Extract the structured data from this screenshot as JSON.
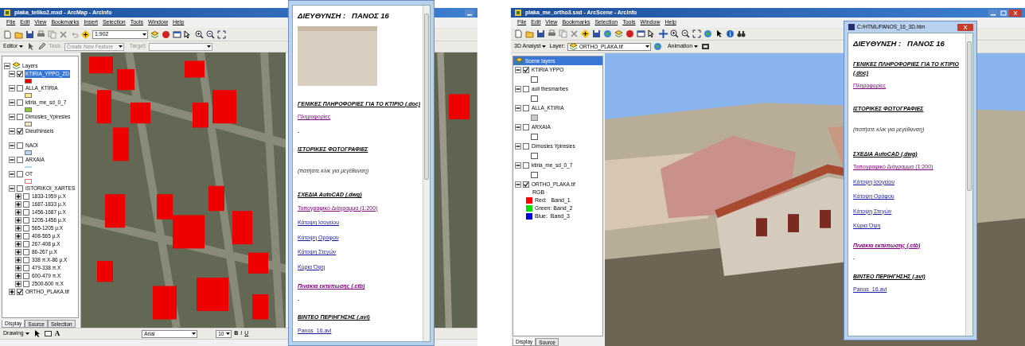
{
  "left_window": {
    "title": "plaka_teliko2.mxd - ArcMap - ArcInfo",
    "menu": [
      "File",
      "Edit",
      "View",
      "Bookmarks",
      "Insert",
      "Selection",
      "Tools",
      "Window",
      "Help"
    ],
    "scale": "1:902",
    "editor_toolbar": {
      "editor": "Editor",
      "task_label": "Task:",
      "task": "Create New Feature",
      "target_label": "Target:"
    },
    "layers": {
      "title": "Layers",
      "items": [
        {
          "label": "KTIRIA_YPPO_ZD",
          "checked": true,
          "selected": true,
          "expanded": true,
          "kind": "fill",
          "color": "#e60000"
        },
        {
          "label": "ALLA_KTIRIA",
          "checked": false,
          "selected": false,
          "expanded": true,
          "kind": "fill",
          "color": "#f5ee8a"
        },
        {
          "label": "ktiria_me_sd_0_7",
          "checked": false,
          "selected": false,
          "expanded": true,
          "kind": "fill",
          "color": "#8cc43c"
        },
        {
          "label": "Dimosies_Ypiresies",
          "checked": false,
          "selected": false,
          "expanded": true,
          "kind": "fill",
          "color": "#efe6c8"
        },
        {
          "label": "Dieuthinseis",
          "checked": true,
          "selected": false,
          "expanded": true,
          "kind": "plain"
        },
        {
          "label": "NAOI",
          "checked": false,
          "selected": false,
          "expanded": true,
          "kind": "fill",
          "color": "#bcd6ee"
        },
        {
          "label": "ARXAIA",
          "checked": false,
          "selected": false,
          "expanded": true,
          "kind": "line",
          "color": "#a8dcf0"
        },
        {
          "label": "OT",
          "checked": false,
          "selected": false,
          "expanded": true,
          "kind": "outline",
          "color": "#e07070"
        },
        {
          "label": "ISTORIKOI_XARTES",
          "checked": false,
          "selected": false,
          "expanded": true,
          "kind": "group",
          "children": [
            {
              "label": "1833-1959 μ.Χ",
              "checked": false,
              "selected": false,
              "expanded": false
            },
            {
              "label": "1687-1833 μ.Χ",
              "checked": false,
              "selected": false,
              "expanded": false
            },
            {
              "label": "1456-1687 μ.Χ",
              "checked": false,
              "selected": false,
              "expanded": false
            },
            {
              "label": "1205-1456 μ.Χ",
              "checked": false,
              "selected": false,
              "expanded": false
            },
            {
              "label": "565-1205 μ.Χ",
              "checked": false,
              "selected": false,
              "expanded": false
            },
            {
              "label": "408-565 μ.Χ",
              "checked": false,
              "selected": false,
              "expanded": false
            },
            {
              "label": "267-408 μ.Χ",
              "checked": false,
              "selected": false,
              "expanded": false
            },
            {
              "label": "86-267 μ.Χ",
              "checked": false,
              "selected": false,
              "expanded": false
            },
            {
              "label": "338 π.Χ-86 μ.Χ",
              "checked": false,
              "selected": false,
              "expanded": false
            },
            {
              "label": "479-338 π.Χ",
              "checked": false,
              "selected": false,
              "expanded": false
            },
            {
              "label": "600-479 π.Χ",
              "checked": false,
              "selected": false,
              "expanded": false
            },
            {
              "label": "2500-600 π.Χ",
              "checked": false,
              "selected": false,
              "expanded": false
            }
          ]
        },
        {
          "label": "ORTHO_PLAKA.tif",
          "checked": true,
          "selected": false,
          "expanded": false
        }
      ]
    },
    "tabs": [
      {
        "label": "Display",
        "selected": true
      },
      {
        "label": "Source",
        "selected": false
      },
      {
        "label": "Selection",
        "selected": false
      }
    ],
    "drawing_toolbar": {
      "drawing": "Drawing",
      "text_tool": "A",
      "font": "Arial",
      "size": "10",
      "bold": "B",
      "italic": "I",
      "underline": "U"
    }
  },
  "popup_left": {
    "heading": "ΔΙΕΥΘΥΝΣΗ :   ΠΑΝΟΣ 16",
    "blocks": [
      {
        "kind": "photo"
      },
      {
        "kind": "section",
        "text": "ΓΕΝΙΚΕΣ ΠΛΗΡΟΦΟΡΙΕΣ ΓΙΑ ΤΟ ΚΤΙΡΙΟ (.doc)"
      },
      {
        "kind": "link",
        "text": "Πληροφορίες",
        "visited": true
      },
      {
        "kind": "dash",
        "text": "-"
      },
      {
        "kind": "section",
        "text": "ΙΣΤΟΡΙΚΕΣ ΦΩΤΟΓΡΑΦΙΕΣ"
      },
      {
        "kind": "note",
        "text": "(πατήστε κλικ για μεγέθυνση)"
      },
      {
        "kind": "section",
        "text": "ΣΧΕΔΙΑ AutoCAD (.dwg)"
      },
      {
        "kind": "link",
        "text": "Τοπογραφικό Διάγραμμα (1:200)",
        "visited": true
      },
      {
        "kind": "link",
        "text": "Κάτοψη Ισογείου",
        "visited": false
      },
      {
        "kind": "link",
        "text": "Κάτοψη Ορόφου",
        "visited": false
      },
      {
        "kind": "link",
        "text": "Κάτοψη Στεγών",
        "visited": false
      },
      {
        "kind": "link",
        "text": "Κύρια Όψη",
        "visited": false
      },
      {
        "kind": "bold_link",
        "text": "Πινάκια εκτύπωσης (.ctb)",
        "visited": true
      },
      {
        "kind": "dash",
        "text": "-"
      },
      {
        "kind": "section",
        "text": "ΒΙΝΤΕΟ ΠΕΡΙΗΓΗΣΗΣ (.avi)"
      },
      {
        "kind": "link",
        "text": "Panos_16.avi",
        "visited": false
      }
    ]
  },
  "right_window": {
    "title": "plaka_me_ortho3.sxd - ArcScene - ArcInfo",
    "menu": [
      "File",
      "Edit",
      "View",
      "Bookmarks",
      "Selection",
      "Tools",
      "Window",
      "Help"
    ],
    "analyst_toolbar": {
      "analyst": "3D Analyst",
      "layer_label": "Layer:",
      "layer": "ORTHO_PLAKA.tif",
      "animation": "Animation"
    },
    "layers": {
      "title": "Scene layers",
      "items": [
        {
          "label": "KTIRIA YPPO",
          "checked": true,
          "expanded": true,
          "kind": "outline",
          "color": "#ffffff"
        },
        {
          "label": "auli thesmarbes",
          "checked": false,
          "expanded": true,
          "kind": "outline",
          "color": "#ffffff"
        },
        {
          "label": "ALLA_KTIRIA",
          "checked": false,
          "expanded": true,
          "kind": "fill",
          "color": "#c8c8c8"
        },
        {
          "label": "ARXAIA",
          "checked": false,
          "expanded": true,
          "kind": "outline",
          "color": "#ffffff"
        },
        {
          "label": "Dimosies Ypiresies",
          "checked": false,
          "expanded": true,
          "kind": "outline",
          "color": "#ffffff"
        },
        {
          "label": "ktiria_me_sd_0_7",
          "checked": false,
          "expanded": true,
          "kind": "outline",
          "color": "#ffffff"
        },
        {
          "label": "ORTHO_PLAKA.tif",
          "checked": true,
          "expanded": true,
          "kind": "raster",
          "legend_title": "RGB",
          "bands": [
            {
              "label": "Red:   Band_1",
              "color": "#ff0000"
            },
            {
              "label": "Green: Band_2",
              "color": "#00e000"
            },
            {
              "label": "Blue:  Band_3",
              "color": "#0000e0"
            }
          ]
        }
      ]
    },
    "tabs": [
      {
        "label": "Display",
        "selected": true
      },
      {
        "label": "Source",
        "selected": false
      }
    ]
  },
  "popup_right": {
    "title": "C:/HTML/PANOS_16_3D.htm",
    "heading": "ΔΙΕΥΘΥΝΣΗ :   ΠΑΝΟΣ 16",
    "blocks": [
      {
        "kind": "section",
        "text": "ΓΕΝΙΚΕΣ ΠΛΗΡΟΦΟΡΙΕΣ ΓΙΑ ΤΟ ΚΤΙΡΙΟ (.doc)"
      },
      {
        "kind": "link",
        "text": "Πληροφορίες",
        "visited": true
      },
      {
        "kind": "section",
        "text": "ΙΣΤΟΡΙΚΕΣ ΦΩΤΟΓΡΑΦΙΕΣ"
      },
      {
        "kind": "note",
        "text": "(πατήστε κλικ για μεγέθυνση)"
      },
      {
        "kind": "section",
        "text": "ΣΧΕΔΙΑ AutoCAD (.dwg)"
      },
      {
        "kind": "link",
        "text": "Τοπογραφικό Διάγραμμα (1:200)",
        "visited": true
      },
      {
        "kind": "link",
        "text": "Κάτοψη Ισογείου",
        "visited": false
      },
      {
        "kind": "link",
        "text": "Κάτοψη Ορόφου",
        "visited": false
      },
      {
        "kind": "link",
        "text": "Κάτοψη Στεγών",
        "visited": false
      },
      {
        "kind": "link",
        "text": "Κύρια Όψη",
        "visited": false
      },
      {
        "kind": "bold_link",
        "text": "Πινάκια εκτύπωσης (.ctb)",
        "visited": true
      },
      {
        "kind": "dash",
        "text": "-"
      },
      {
        "kind": "section",
        "text": "ΒΙΝΤΕΟ ΠΕΡΙΗΓΗΣΗΣ (.avi)"
      },
      {
        "kind": "link",
        "text": "Panos_16.avi",
        "visited": false
      }
    ]
  }
}
